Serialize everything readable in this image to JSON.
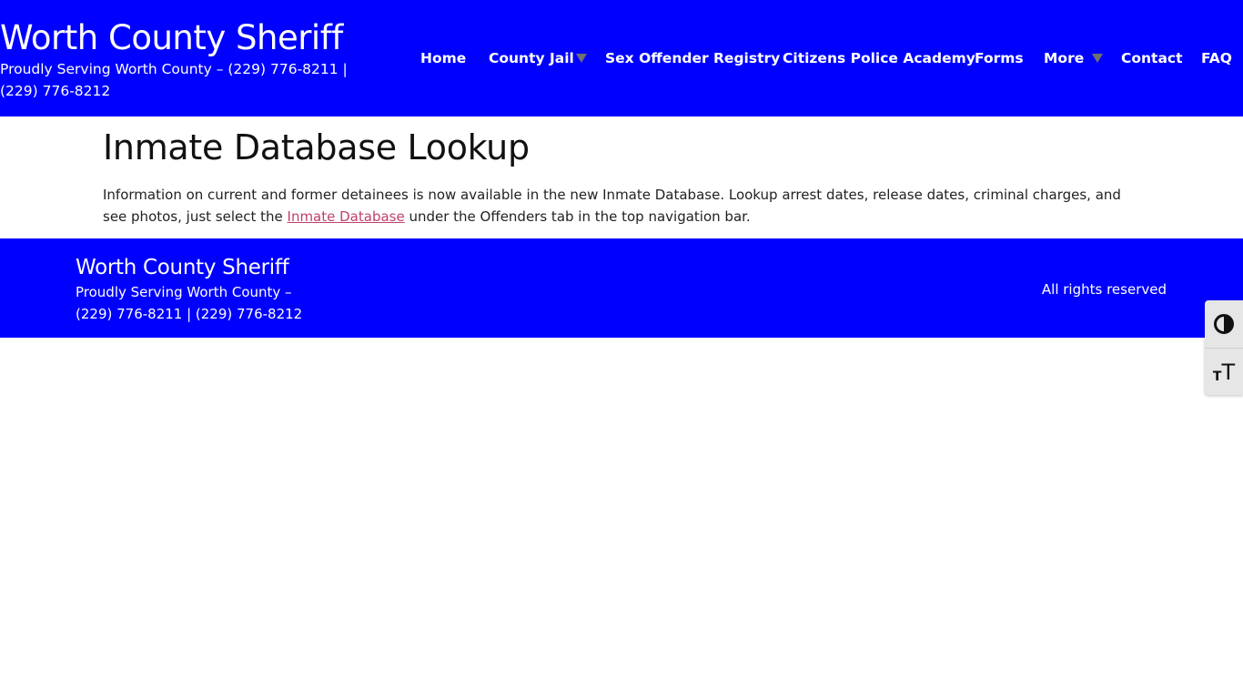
{
  "header": {
    "site_title": "Worth County Sheriff",
    "tagline": "Proudly Serving Worth County – (229) 776-8211 | (229) 776-8212",
    "background_color": "#0000ff"
  },
  "nav": {
    "items": [
      {
        "label": "Home",
        "has_dropdown": false
      },
      {
        "label": "County Jail",
        "has_dropdown": true
      },
      {
        "label": "Sex Offender Registry",
        "has_dropdown": false
      },
      {
        "label": "Citizens Police Academy",
        "has_dropdown": false
      },
      {
        "label": "Forms",
        "has_dropdown": false
      },
      {
        "label": "More",
        "has_dropdown": true
      },
      {
        "label": "Contact",
        "has_dropdown": false
      },
      {
        "label": "FAQ",
        "has_dropdown": false
      }
    ]
  },
  "main": {
    "title": "Inmate Database Lookup",
    "paragraph_before_link": "Information on current and former detainees is now available in the new Inmate Database. Lookup arrest dates, release dates, criminal charges, and see photos, just select the ",
    "link_text": "Inmate Database",
    "paragraph_after_link": " under the Offenders tab in the top navigation bar.",
    "link_color": "#c0406a"
  },
  "footer": {
    "site_title": "Worth County Sheriff",
    "tagline_line1": "Proudly Serving Worth County –",
    "tagline_line2": "(229) 776-8211 | (229) 776-8212",
    "rights": "All rights reserved"
  },
  "accessibility_toolbar": {
    "buttons": [
      {
        "icon": "contrast-icon",
        "label": "Toggle High Contrast"
      },
      {
        "icon": "font-size-icon",
        "label": "Toggle Font size"
      }
    ]
  }
}
